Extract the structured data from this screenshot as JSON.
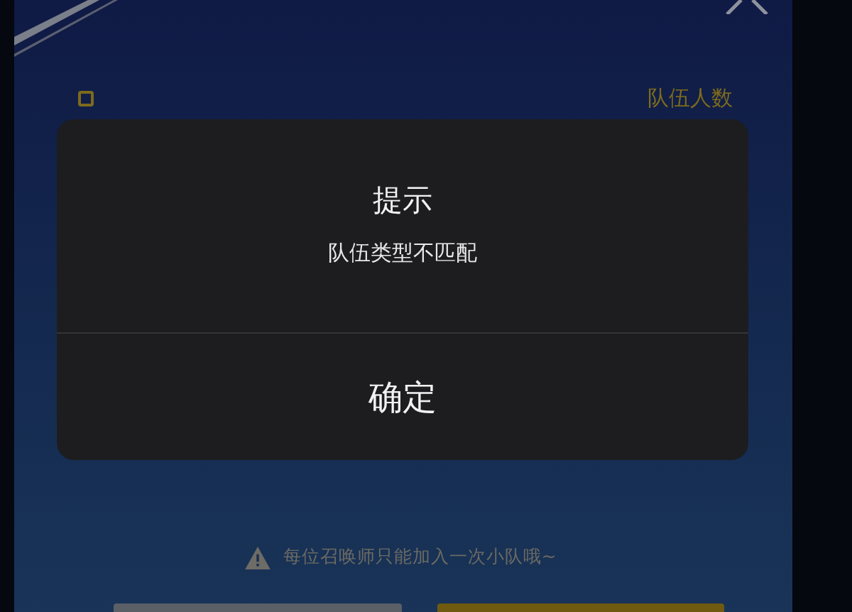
{
  "panel": {
    "header_label": "队伍人数",
    "notice": "每位召唤师只能加入一次小队哦~"
  },
  "dialog": {
    "title": "提示",
    "message": "队伍类型不匹配",
    "buttons": [
      "确定"
    ]
  }
}
